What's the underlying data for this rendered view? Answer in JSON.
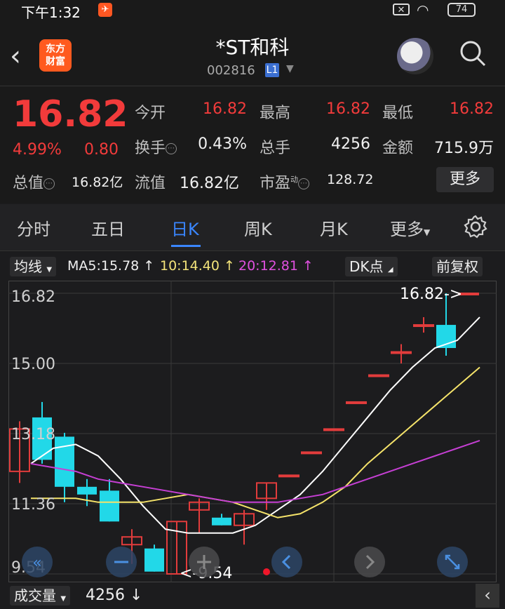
{
  "status": {
    "time": "下午1:32",
    "battery": "74"
  },
  "header": {
    "title": "*ST和科",
    "code": "002816",
    "level": "L1",
    "logo_line1": "东方",
    "logo_line2": "财富"
  },
  "quote": {
    "price": "16.82",
    "pct": "4.99%",
    "change": "0.80",
    "open_label": "今开",
    "open": "16.82",
    "high_label": "最高",
    "high": "16.82",
    "low_label": "最低",
    "low": "16.82",
    "turnover_label": "换手",
    "turnover": "0.43%",
    "volume_label": "总手",
    "volume": "4256",
    "amount_label": "金额",
    "amount": "715.9万",
    "total_cap_label": "总值",
    "total_cap": "16.82亿",
    "float_cap_label": "流值",
    "float_cap": "16.82亿",
    "pe_label": "市盈",
    "pe_sup": "动",
    "pe": "128.72",
    "more": "更多"
  },
  "tabs": {
    "fenshi": "分时",
    "wuri": "五日",
    "rik": "日K",
    "zhouk": "周K",
    "yuek": "月K",
    "more": "更多"
  },
  "indicators": {
    "ma_selector": "均线",
    "ma5": "MA5:15.78",
    "ma10": "10:14.40",
    "ma20": "20:12.81",
    "dk": "DK点",
    "fq": "前复权"
  },
  "chart_data": {
    "type": "candlestick",
    "y_ticks": [
      "16.82",
      "15.00",
      "13.18",
      "11.36",
      "9.54"
    ],
    "max_label": "16.82->",
    "min_label": "<-9.54",
    "candles": [
      {
        "o": 12.2,
        "h": 13.5,
        "l": 11.9,
        "c": 13.3,
        "color": "up"
      },
      {
        "o": 13.6,
        "h": 14.0,
        "l": 12.4,
        "c": 12.5,
        "color": "down"
      },
      {
        "o": 13.1,
        "h": 13.2,
        "l": 11.4,
        "c": 11.8,
        "color": "down"
      },
      {
        "o": 11.8,
        "h": 12.0,
        "l": 11.3,
        "c": 11.6,
        "color": "down"
      },
      {
        "o": 11.7,
        "h": 12.0,
        "l": 10.9,
        "c": 10.9,
        "color": "down"
      },
      {
        "o": 10.3,
        "h": 10.7,
        "l": 9.8,
        "c": 10.5,
        "color": "up"
      },
      {
        "o": 10.2,
        "h": 10.3,
        "l": 9.6,
        "c": 9.6,
        "color": "down"
      },
      {
        "o": 9.54,
        "h": 10.9,
        "l": 9.54,
        "c": 10.9,
        "color": "up"
      },
      {
        "o": 11.2,
        "h": 11.5,
        "l": 10.6,
        "c": 11.4,
        "color": "up"
      },
      {
        "o": 11.0,
        "h": 11.1,
        "l": 10.8,
        "c": 10.8,
        "color": "down"
      },
      {
        "o": 10.8,
        "h": 11.2,
        "l": 10.3,
        "c": 11.1,
        "color": "up"
      },
      {
        "o": 11.5,
        "h": 11.9,
        "l": 11.2,
        "c": 11.9,
        "color": "up"
      },
      {
        "o": 12.1,
        "h": 12.1,
        "l": 12.1,
        "c": 12.1,
        "color": "up"
      },
      {
        "o": 12.7,
        "h": 12.7,
        "l": 12.7,
        "c": 12.7,
        "color": "up"
      },
      {
        "o": 13.3,
        "h": 13.3,
        "l": 13.3,
        "c": 13.3,
        "color": "up"
      },
      {
        "o": 14.0,
        "h": 14.0,
        "l": 14.0,
        "c": 14.0,
        "color": "up"
      },
      {
        "o": 14.7,
        "h": 14.7,
        "l": 14.7,
        "c": 14.7,
        "color": "up"
      },
      {
        "o": 15.3,
        "h": 15.5,
        "l": 15.0,
        "c": 15.3,
        "color": "up"
      },
      {
        "o": 16.0,
        "h": 16.2,
        "l": 15.8,
        "c": 16.0,
        "color": "up"
      },
      {
        "o": 16.0,
        "h": 16.82,
        "l": 15.2,
        "c": 15.4,
        "color": "down"
      },
      {
        "o": 16.82,
        "h": 16.82,
        "l": 16.82,
        "c": 16.82,
        "color": "up"
      }
    ],
    "ma5_line": [
      12.4,
      12.8,
      12.9,
      12.6,
      12.0,
      11.3,
      10.7,
      10.6,
      10.6,
      10.6,
      10.8,
      11.2,
      11.6,
      12.2,
      12.9,
      13.6,
      14.3,
      14.9,
      15.4,
      15.6,
      16.2
    ],
    "ma10_line": [
      11.5,
      11.5,
      11.5,
      11.4,
      11.4,
      11.4,
      11.5,
      11.6,
      11.5,
      11.4,
      11.2,
      11.0,
      11.1,
      11.4,
      11.8,
      12.4,
      12.9,
      13.4,
      13.9,
      14.4,
      14.9
    ],
    "ma20_line": [
      12.4,
      12.3,
      12.2,
      12.0,
      11.9,
      11.8,
      11.7,
      11.6,
      11.5,
      11.4,
      11.4,
      11.4,
      11.5,
      11.6,
      11.8,
      12.0,
      12.2,
      12.4,
      12.6,
      12.8,
      13.0
    ],
    "ylim": [
      9.54,
      16.82
    ],
    "colors": {
      "up": "#e23c3c",
      "down": "#22d8e8",
      "ma5": "#ffffff",
      "ma10": "#f5e36a",
      "ma20": "#c63fd4"
    }
  },
  "bottom": {
    "selector": "成交量",
    "value": "4256"
  }
}
